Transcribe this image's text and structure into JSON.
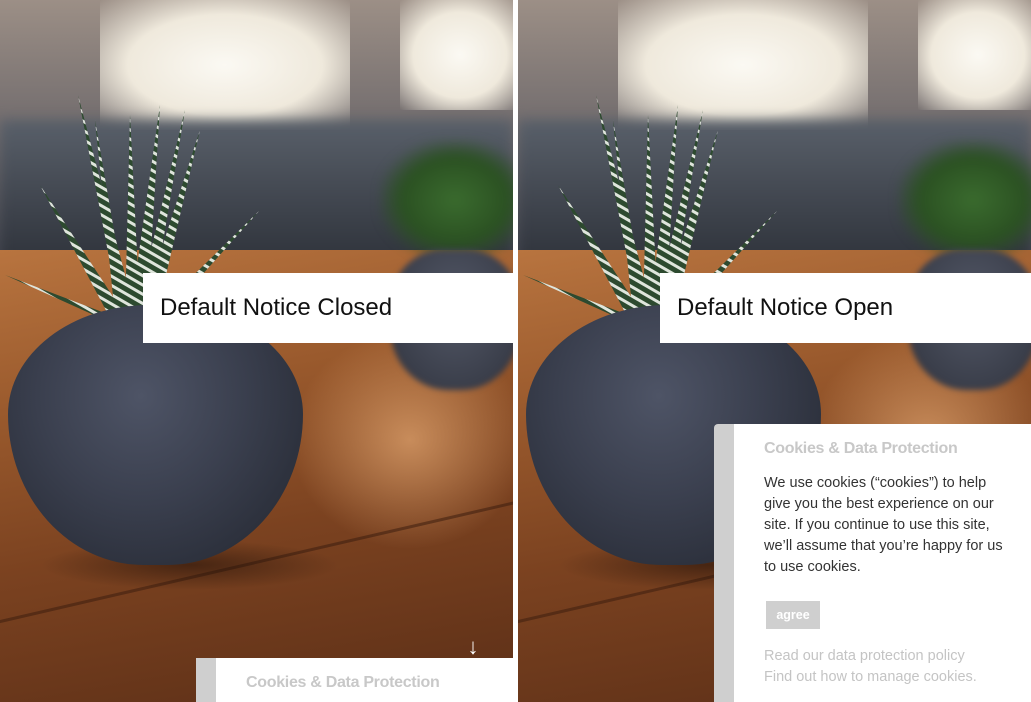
{
  "panels": {
    "left": {
      "label": "Default Notice Closed",
      "notice_title": "Cookies & Data Protection",
      "arrow_icon": "arrow-down-icon"
    },
    "right": {
      "label": "Default Notice Open",
      "notice": {
        "title": "Cookies & Data Protection",
        "body": "We use cookies (“cookies”) to help give you the best experience on our site. If you continue to use this site, we’ll assume that you’re happy for us to use cookies.",
        "agree_label": "agree",
        "links": [
          "Read our data protection policy",
          "Find out how to manage cookies."
        ]
      }
    }
  },
  "colors": {
    "notice_accent": "#cfcfcf",
    "notice_title": "#c8c8c8",
    "body_text": "#333333",
    "link": "#c4c4c4"
  }
}
